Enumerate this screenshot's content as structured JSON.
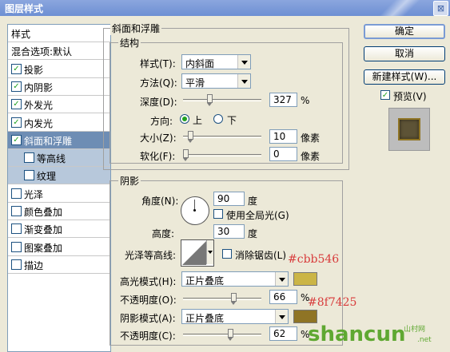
{
  "window": {
    "title": "图层样式",
    "close_label": "⊠"
  },
  "style_list": [
    {
      "label": "样式",
      "checkbox": false,
      "checked": false,
      "state": "normal"
    },
    {
      "label": "混合选项:默认",
      "checkbox": false,
      "checked": false,
      "state": "normal"
    },
    {
      "label": "投影",
      "checkbox": true,
      "checked": true,
      "state": "normal"
    },
    {
      "label": "内阴影",
      "checkbox": true,
      "checked": true,
      "state": "normal"
    },
    {
      "label": "外发光",
      "checkbox": true,
      "checked": true,
      "state": "normal"
    },
    {
      "label": "内发光",
      "checkbox": true,
      "checked": true,
      "state": "normal"
    },
    {
      "label": "斜面和浮雕",
      "checkbox": true,
      "checked": true,
      "state": "selected"
    },
    {
      "label": "等高线",
      "checkbox": true,
      "checked": false,
      "state": "sub"
    },
    {
      "label": "纹理",
      "checkbox": true,
      "checked": false,
      "state": "sub"
    },
    {
      "label": "光泽",
      "checkbox": true,
      "checked": false,
      "state": "normal"
    },
    {
      "label": "颜色叠加",
      "checkbox": true,
      "checked": false,
      "state": "normal"
    },
    {
      "label": "渐变叠加",
      "checkbox": true,
      "checked": false,
      "state": "normal"
    },
    {
      "label": "图案叠加",
      "checkbox": true,
      "checked": false,
      "state": "normal"
    },
    {
      "label": "描边",
      "checkbox": true,
      "checked": false,
      "state": "normal"
    }
  ],
  "bevel": {
    "section_title": "斜面和浮雕",
    "structure_title": "结构",
    "style_label": "样式(T):",
    "style_value": "内斜面",
    "method_label": "方法(Q):",
    "method_value": "平滑",
    "depth_label": "深度(D):",
    "depth_value": "327",
    "depth_unit": "%",
    "depth_slider_fraction": 0.33,
    "direction_label": "方向:",
    "direction_up": "上",
    "direction_down": "下",
    "direction_selected": "上",
    "size_label": "大小(Z):",
    "size_value": "10",
    "size_unit": "像素",
    "size_slider_fraction": 0.07,
    "soften_label": "软化(F):",
    "soften_value": "0",
    "soften_unit": "像素",
    "soften_slider_fraction": 0.0
  },
  "shading": {
    "title": "阴影",
    "angle_label": "角度(N):",
    "angle_value": "90",
    "angle_unit": "度",
    "global_light_label": "使用全局光(G)",
    "global_light_checked": false,
    "altitude_label": "高度:",
    "altitude_value": "30",
    "altitude_unit": "度",
    "gloss_contour_label": "光泽等高线:",
    "antialias_label": "消除锯齿(L)",
    "antialias_checked": false,
    "highlight_mode_label": "高光模式(H):",
    "highlight_mode_value": "正片叠底",
    "highlight_color": "#cbb546",
    "highlight_opacity_label": "不透明度(O):",
    "highlight_opacity_value": "66",
    "highlight_opacity_unit": "%",
    "highlight_opacity_fraction": 0.66,
    "shadow_mode_label": "阴影模式(A):",
    "shadow_mode_value": "正片叠底",
    "shadow_color": "#8f7425",
    "shadow_opacity_label": "不透明度(C):",
    "shadow_opacity_value": "62",
    "shadow_opacity_unit": "%",
    "shadow_opacity_fraction": 0.62
  },
  "annotations": {
    "highlight_hex": "#cbb546",
    "shadow_hex": "#8f7425",
    "annotation_color": "#d83b3b"
  },
  "buttons": {
    "ok": "确定",
    "cancel": "取消",
    "new_style": "新建样式(W)...",
    "preview": "预览(V)",
    "preview_checked": true
  },
  "watermark": {
    "text": "shancun",
    "suffix": ".net",
    "tag": "山村网"
  }
}
